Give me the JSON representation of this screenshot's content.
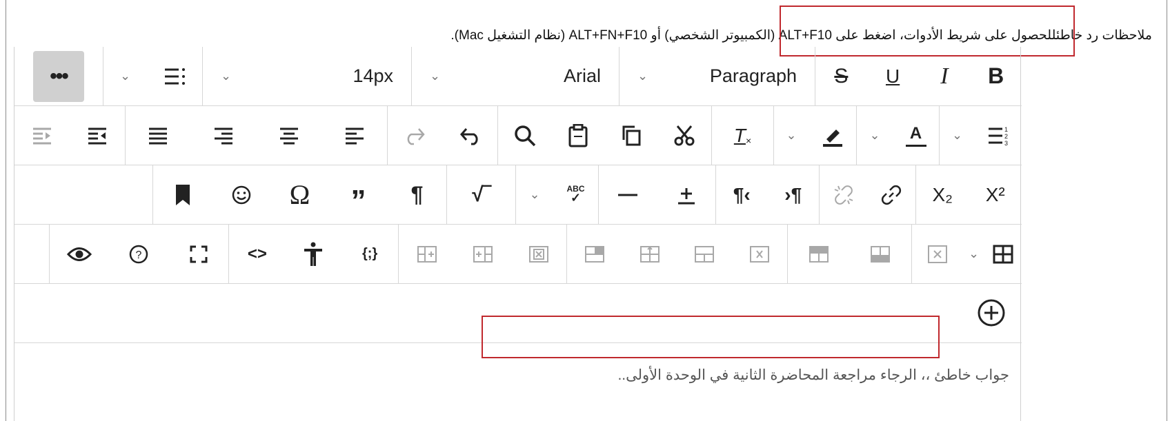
{
  "instruction": "ملاحظات رد خاطئللحصول على شريط الأدوات، اضغط على ALT+F10 (الكمبيوتر الشخصي) أو ALT+FN+F10 (نظام التشغيل Mac).",
  "toolbar": {
    "row1": {
      "bold": "B",
      "italic": "I",
      "underline": "U",
      "strikethrough": "S",
      "paragraph_style": "Paragraph",
      "font_family": "Arial",
      "font_size": "14px",
      "more": "•••"
    },
    "row2": {
      "text_color": "A",
      "clear_format": "T"
    },
    "row3": {
      "superscript": "X²",
      "subscript": "X₂",
      "special_char": "Ω",
      "spellcheck_label": "ABC"
    },
    "row4": {
      "code": "<>",
      "code_sample": "{;}"
    }
  },
  "answer_text": "جواب خاطئ ،، الرجاء مراجعة المحاضرة الثانية في الوحدة الأولى..",
  "colors": {
    "highlight_border": "#c0282d",
    "toolbar_border": "#d6d6d6",
    "disabled_icon": "#a8a8a8"
  }
}
